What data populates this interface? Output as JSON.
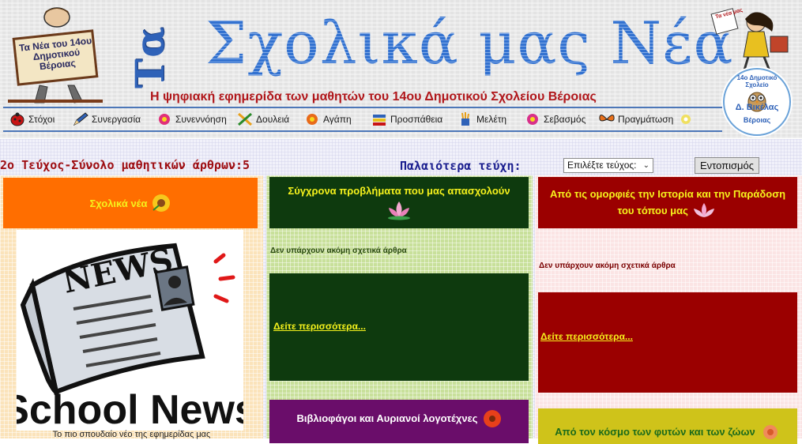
{
  "header": {
    "mascot_left_sign": "Τα Νέα του 14ου Δημοτικού Βέροιας",
    "title_prefix": "Τα",
    "title_main": "Σχολικά μας Νέα",
    "subtitle": "Η ψηφιακή εφημερίδα των μαθητών του 14ου Δημοτικού Σχολείου Βέροιας",
    "mascot_right_sign": "Τα νέα μας",
    "seal_top": "14ο Δημοτικό Σχολείο",
    "seal_name": "Δ. Βικέλας",
    "seal_city": "Βέροιας"
  },
  "nav": {
    "items": [
      {
        "label": "Στόχοι",
        "icon": "ladybug-icon"
      },
      {
        "label": "Συνεργασία",
        "icon": "pencil-icon"
      },
      {
        "label": "Συνεννόηση",
        "icon": "flower-icon"
      },
      {
        "label": "Δουλειά",
        "icon": "crossed-pencils-icon"
      },
      {
        "label": "Αγάπη",
        "icon": "flower-icon"
      },
      {
        "label": "Προσπάθεια",
        "icon": "books-icon"
      },
      {
        "label": "Μελέτη",
        "icon": "pencil-cup-icon"
      },
      {
        "label": "Σεβασμός",
        "icon": "flower-icon"
      },
      {
        "label": "Πραγμάτωση",
        "icon": "butterfly-icon"
      }
    ]
  },
  "toolbar": {
    "issue_summary": "2ο Τεύχος-Σύνολο μαθητικών άρθρων:5",
    "older_issues_label": "Παλαιότερα τεύχη:",
    "select_value": "Επιλέξτε τεύχος:",
    "find_button": "Εντοπισμός"
  },
  "sections": {
    "school_news": {
      "title": "Σχολικά νέα",
      "image_text": "School News",
      "image_headline": "NEWS",
      "caption": "Το πιο σπουδαίο νέο της εφημερίδας μας"
    },
    "problems": {
      "title": "Σύγχρονα προβλήματα που μας απασχολούν",
      "no_articles": "Δεν υπάρχουν ακόμη σχετικά άρθρα",
      "more": "Δείτε περισσότερα..."
    },
    "history": {
      "title": "Από τις ομορφιές την Ιστορία και την Παράδοση του τόπου μας",
      "no_articles": "Δεν υπάρχουν ακόμη σχετικά άρθρα",
      "more": "Δείτε περισσότερα..."
    },
    "bookworms": {
      "title": "Βιβλιοφάγοι και Αυριανοί λογοτέχνες"
    },
    "nature": {
      "title": "Από τον κόσμο των φυτών και των ζώων"
    }
  },
  "colors": {
    "title_blue": "#3372d0",
    "subtitle_red": "#b0161a",
    "box_orange": "#ff6e00",
    "box_green": "#0e3a0e",
    "box_red": "#9b0000",
    "box_purple": "#6a0d6a",
    "box_olive": "#cfc31a",
    "heading_yellow": "#f6f21c"
  }
}
